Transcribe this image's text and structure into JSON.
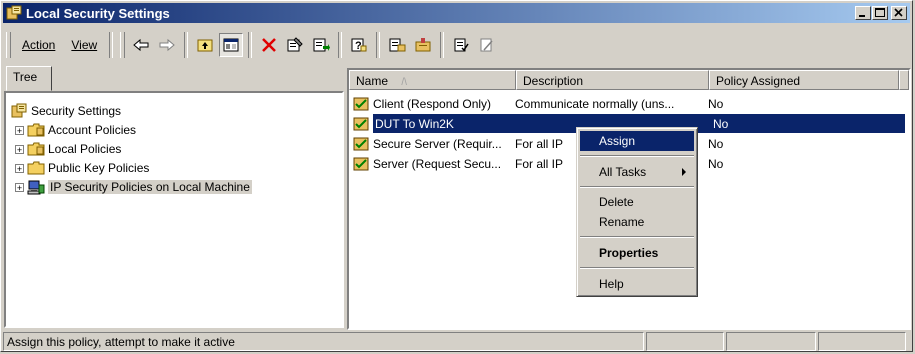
{
  "window": {
    "title": "Local Security Settings",
    "buttons": [
      "_",
      "□",
      "×"
    ]
  },
  "toolbar": {
    "menu": [
      {
        "label": "Action"
      },
      {
        "label": "View"
      }
    ],
    "tools": [
      "back-icon",
      "forward-icon",
      "up-level-icon",
      "show-tree-icon",
      "delete-icon",
      "properties-icon",
      "export-list-icon",
      "help-icon",
      "add-filter-icon",
      "manage-filters-icon",
      "assign-icon",
      "unassign-icon"
    ]
  },
  "tree": {
    "tab_label": "Tree",
    "root": "Security Settings",
    "items": [
      {
        "label": "Account Policies"
      },
      {
        "label": "Local Policies"
      },
      {
        "label": "Public Key Policies"
      },
      {
        "label": "IP Security Policies on Local Machine"
      }
    ]
  },
  "list": {
    "columns": [
      "Name",
      "Description",
      "Policy Assigned"
    ],
    "sort_indicator": "/\\",
    "rows": [
      {
        "name": "Client (Respond Only)",
        "description": "Communicate normally (uns...",
        "assigned": "No"
      },
      {
        "name": "DUT To Win2K",
        "description": "",
        "assigned": "No"
      },
      {
        "name": "Secure Server (Requir...",
        "description": "For all IP",
        "assigned": "No"
      },
      {
        "name": "Server (Request Secu...",
        "description": "For all IP",
        "assigned": "No"
      }
    ]
  },
  "context_menu": {
    "items": [
      "Assign",
      "All Tasks",
      "Delete",
      "Rename",
      "Properties",
      "Help"
    ]
  },
  "status": {
    "text": "Assign this policy, attempt to make it active"
  },
  "colors": {
    "title_start": "#0a246a",
    "title_end": "#a6caf0",
    "selection": "#0a246a",
    "face": "#d4d0c8"
  }
}
